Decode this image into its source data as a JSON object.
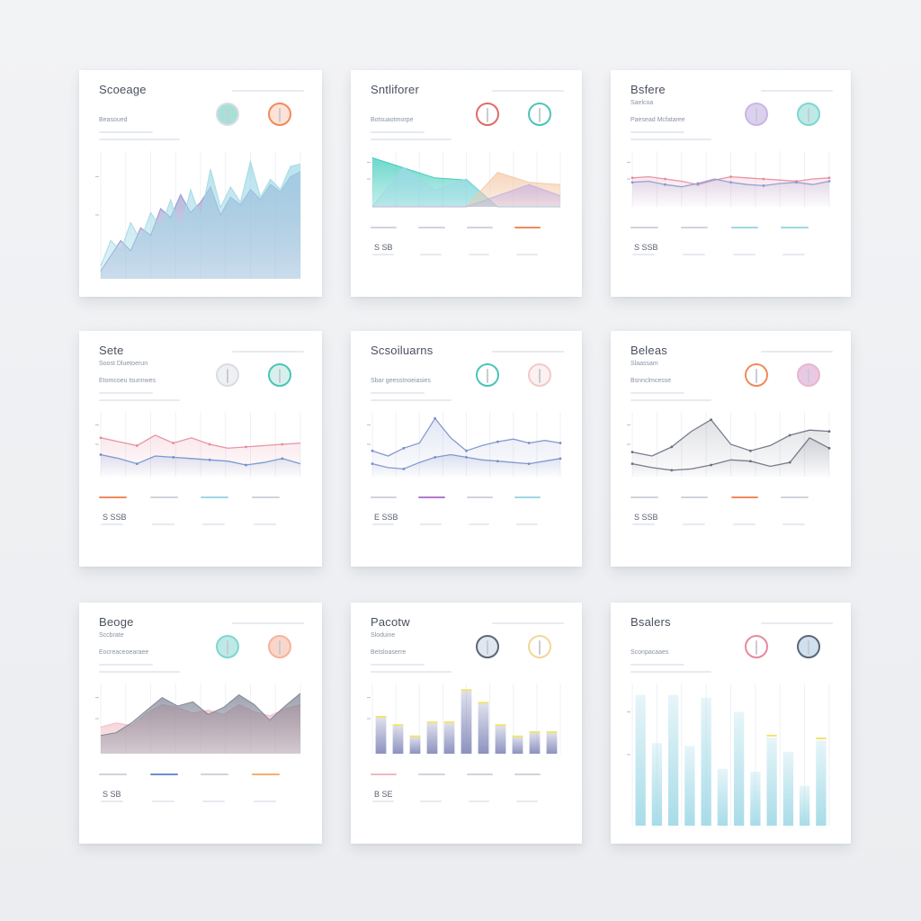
{
  "cards": [
    {
      "id": "card-1",
      "title": "Scoeage",
      "subtitle": "",
      "label": "Beasoued",
      "icons": [
        {
          "name": "gauge-icon",
          "ring": "#d9dde3",
          "fill": "#a8e0d8"
        },
        {
          "name": "gauge-icon",
          "ring": "#f08a5d",
          "fill": "#fde2d5"
        }
      ],
      "stats": [],
      "chart_data": {
        "type": "area",
        "x": [
          0,
          1,
          2,
          3,
          4,
          5,
          6,
          7,
          8,
          9,
          10,
          11,
          12,
          13,
          14,
          15,
          16,
          17,
          18,
          19,
          20
        ],
        "series": [
          {
            "name": "",
            "color": "#8f93c9",
            "values": [
              6,
              18,
              30,
              22,
              40,
              34,
              55,
              48,
              66,
              52,
              60,
              72,
              50,
              64,
              58,
              70,
              62,
              74,
              68,
              80,
              84
            ]
          },
          {
            "name": "",
            "color": "#9ed8e6",
            "values": [
              10,
              30,
              22,
              44,
              30,
              52,
              40,
              62,
              38,
              70,
              48,
              86,
              56,
              72,
              60,
              92,
              64,
              78,
              70,
              88,
              90
            ]
          }
        ],
        "ylim": [
          0,
          100
        ]
      }
    },
    {
      "id": "card-2",
      "title": "Sntliforer",
      "subtitle": "",
      "label": "Botsuaotmorpe",
      "icons": [
        {
          "name": "gauge-icon",
          "ring": "#e06a6a",
          "fill": "#ffffff"
        },
        {
          "name": "gauge-icon",
          "ring": "#4cc4b8",
          "fill": "#ffffff"
        }
      ],
      "stats": [
        {
          "value": "S SB",
          "caption": "",
          "dash": "#cfd4dc"
        },
        {
          "value": "",
          "caption": "",
          "dash": "#cfd4dc"
        },
        {
          "value": "",
          "caption": "",
          "dash": "#cfd4dc"
        },
        {
          "value": "",
          "caption": "",
          "dash": "#f08a5d"
        }
      ],
      "chart_data": {
        "type": "area",
        "categories": [
          "1",
          "2",
          "3",
          "4",
          "5",
          "6",
          "7"
        ],
        "series": [
          {
            "name": "",
            "color": "#36c9b9",
            "values": [
              88,
              70,
              52,
              48,
              0,
              0,
              0
            ]
          },
          {
            "name": "",
            "color": "#9ed8e6",
            "values": [
              0,
              70,
              30,
              50,
              0,
              0,
              0
            ]
          },
          {
            "name": "",
            "color": "#f4c7a4",
            "values": [
              0,
              0,
              0,
              0,
              62,
              44,
              40
            ]
          },
          {
            "name": "",
            "color": "#c7b0df",
            "values": [
              0,
              0,
              0,
              0,
              20,
              40,
              20
            ]
          }
        ],
        "ylim": [
          0,
          100
        ]
      }
    },
    {
      "id": "card-3",
      "title": "Bsfere",
      "subtitle": "Saelcoa",
      "label": "Paesead Mcfataree",
      "icons": [
        {
          "name": "gauge-icon",
          "ring": "#c9b6e4",
          "fill": "#dcd0ef"
        },
        {
          "name": "gauge-icon",
          "ring": "#7fd6d0",
          "fill": "#bde9e6"
        }
      ],
      "stats": [
        {
          "value": "S SSB",
          "caption": "",
          "dash": "#cfd4dc"
        },
        {
          "value": "",
          "caption": "",
          "dash": "#cfd4dc"
        },
        {
          "value": "",
          "caption": "",
          "dash": "#9ed8e6"
        },
        {
          "value": "",
          "caption": "",
          "dash": "#9ed8e6"
        }
      ],
      "chart_data": {
        "type": "line",
        "x": [
          0,
          1,
          2,
          3,
          4,
          5,
          6,
          7,
          8,
          9,
          10,
          11,
          12
        ],
        "series": [
          {
            "name": "",
            "color": "#e58a9d",
            "values": [
              52,
              54,
              50,
              46,
              40,
              48,
              54,
              52,
              50,
              48,
              46,
              50,
              52
            ]
          },
          {
            "name": "",
            "color": "#8a9ad6",
            "values": [
              44,
              46,
              40,
              36,
              42,
              50,
              44,
              40,
              38,
              42,
              44,
              40,
              46
            ]
          }
        ],
        "ylim": [
          0,
          100
        ]
      }
    },
    {
      "id": "card-4",
      "title": "Sete",
      "subtitle": "Soost Dluetoerun",
      "label": "Etomcoeu tsunnwes",
      "icons": [
        {
          "name": "gauge-icon",
          "ring": "#d9dde3",
          "fill": "#eef0f3"
        },
        {
          "name": "gauge-icon",
          "ring": "#4cc4b8",
          "fill": "#d7f0ee"
        }
      ],
      "stats": [
        {
          "value": "S SSB",
          "caption": "",
          "dash": "#f08a5d"
        },
        {
          "value": "",
          "caption": "",
          "dash": "#cfd4dc"
        },
        {
          "value": "",
          "caption": "",
          "dash": "#9ed8e6"
        },
        {
          "value": "",
          "caption": "",
          "dash": "#cfd4dc"
        }
      ],
      "chart_data": {
        "type": "line",
        "x": [
          0,
          1,
          2,
          3,
          4,
          5,
          6,
          7,
          8,
          9,
          10,
          11
        ],
        "series": [
          {
            "name": "",
            "color": "#e58a9d",
            "values": [
              60,
              54,
              48,
              64,
              52,
              60,
              50,
              44,
              46,
              48,
              50,
              52
            ]
          },
          {
            "name": "",
            "color": "#6f8fd0",
            "values": [
              34,
              28,
              20,
              32,
              30,
              28,
              26,
              24,
              18,
              22,
              28,
              20
            ]
          }
        ],
        "ylim": [
          0,
          100
        ]
      }
    },
    {
      "id": "card-5",
      "title": "Scsoiluarns",
      "subtitle": "",
      "label": "Sbar geesstnoeiasies",
      "icons": [
        {
          "name": "gauge-icon",
          "ring": "#4cc4b8",
          "fill": "#ffffff"
        },
        {
          "name": "gauge-icon",
          "ring": "#f1c9c9",
          "fill": "#fdf0f0"
        }
      ],
      "stats": [
        {
          "value": "E SSB",
          "caption": "",
          "dash": "#cfd4dc"
        },
        {
          "value": "",
          "caption": "",
          "dash": "#b07ad0"
        },
        {
          "value": "",
          "caption": "",
          "dash": "#cfd4dc"
        },
        {
          "value": "",
          "caption": "",
          "dash": "#9ed8e6"
        }
      ],
      "chart_data": {
        "type": "line",
        "x": [
          0,
          1,
          2,
          3,
          4,
          5,
          6,
          7,
          8,
          9,
          10,
          11,
          12
        ],
        "series": [
          {
            "name": "",
            "color": "#7a8fc9",
            "values": [
              40,
              32,
              44,
              52,
              90,
              60,
              40,
              48,
              54,
              58,
              52,
              56,
              52
            ]
          },
          {
            "name": "",
            "color": "#7a8fc9",
            "values": [
              20,
              14,
              12,
              22,
              30,
              34,
              30,
              26,
              24,
              22,
              20,
              24,
              28
            ]
          }
        ],
        "ylim": [
          0,
          100
        ]
      }
    },
    {
      "id": "card-6",
      "title": "Beleas",
      "subtitle": "Slaassam",
      "label": "Bsnnclmcesse",
      "icons": [
        {
          "name": "gauge-icon",
          "ring": "#f08a5d",
          "fill": "#ffffff"
        },
        {
          "name": "gauge-icon",
          "ring": "#e7b8ce",
          "fill": "#e9c8e4"
        }
      ],
      "stats": [
        {
          "value": "S SSB",
          "caption": "",
          "dash": "#cfd4dc"
        },
        {
          "value": "",
          "caption": "",
          "dash": "#cfd4dc"
        },
        {
          "value": "",
          "caption": "",
          "dash": "#f08a5d"
        },
        {
          "value": "",
          "caption": "",
          "dash": "#cfd4dc"
        }
      ],
      "chart_data": {
        "type": "line",
        "x": [
          0,
          1,
          2,
          3,
          4,
          5,
          6,
          7,
          8,
          9,
          10
        ],
        "series": [
          {
            "name": "",
            "color": "#6a6f80",
            "values": [
              38,
              32,
              46,
              70,
              88,
              50,
              40,
              48,
              64,
              72,
              70
            ]
          },
          {
            "name": "",
            "color": "#6a6f80",
            "values": [
              20,
              14,
              10,
              12,
              18,
              26,
              24,
              16,
              22,
              60,
              44
            ]
          }
        ],
        "ylim": [
          0,
          100
        ]
      }
    },
    {
      "id": "card-7",
      "title": "Beoge",
      "subtitle": "Sccbrate",
      "label": "Eocreaceoearaee",
      "icons": [
        {
          "name": "gauge-icon",
          "ring": "#7fd6d0",
          "fill": "#bde9e6"
        },
        {
          "name": "gauge-icon",
          "ring": "#f4b39e",
          "fill": "#fad6c8"
        }
      ],
      "stats": [
        {
          "value": "S SB",
          "caption": "",
          "dash": "#cfd4dc"
        },
        {
          "value": "",
          "caption": "",
          "dash": "#6f8fd0"
        },
        {
          "value": "",
          "caption": "",
          "dash": "#cfd4dc"
        },
        {
          "value": "",
          "caption": "",
          "dash": "#f4b06a"
        }
      ],
      "chart_data": {
        "type": "area",
        "x": [
          0,
          1,
          2,
          3,
          4,
          5,
          6,
          7,
          8,
          9,
          10,
          11,
          12,
          13
        ],
        "series": [
          {
            "name": "",
            "color": "#f0b7bf",
            "values": [
              38,
              44,
              40,
              58,
              70,
              66,
              58,
              62,
              56,
              70,
              60,
              54,
              64,
              70
            ]
          },
          {
            "name": "",
            "color": "#7a8090",
            "values": [
              26,
              30,
              44,
              62,
              80,
              68,
              74,
              56,
              66,
              84,
              70,
              48,
              68,
              86
            ]
          }
        ],
        "ylim": [
          0,
          100
        ]
      }
    },
    {
      "id": "card-8",
      "title": "Pacotw",
      "subtitle": "Sloduine",
      "label": "Betsloaserre",
      "icons": [
        {
          "name": "gauge-icon",
          "ring": "#5d6577",
          "fill": "#dfe7f0"
        },
        {
          "name": "gauge-icon",
          "ring": "#f2d69a",
          "fill": "#ffffff"
        }
      ],
      "stats": [
        {
          "value": "B SE",
          "caption": "",
          "dash": "#f0b7bf"
        },
        {
          "value": "",
          "caption": "",
          "dash": "#cfd4dc"
        },
        {
          "value": "",
          "caption": "",
          "dash": "#cfd4dc"
        },
        {
          "value": "",
          "caption": "",
          "dash": "#cfd4dc"
        }
      ],
      "chart_data": {
        "type": "bar",
        "categories": [
          "1",
          "2",
          "3",
          "4",
          "5",
          "6",
          "7",
          "8",
          "9",
          "10",
          "11"
        ],
        "series": [
          {
            "name": "",
            "color": "#7f86b8",
            "values": [
              52,
              40,
              24,
              44,
              44,
              90,
              72,
              40,
              24,
              30,
              30
            ]
          },
          {
            "name": "",
            "color": "#f2e46a",
            "values": [
              54,
              42,
              26,
              46,
              46,
              92,
              74,
              42,
              26,
              32,
              32
            ]
          }
        ],
        "ylim": [
          0,
          100
        ]
      }
    },
    {
      "id": "card-9",
      "title": "Bsalers",
      "subtitle": "",
      "label": "Sconpacaaes",
      "icons": [
        {
          "name": "gauge-icon",
          "ring": "#e58a9d",
          "fill": "#ffffff"
        },
        {
          "name": "gauge-icon",
          "ring": "#5d6577",
          "fill": "#cfe0ee"
        }
      ],
      "stats": [],
      "chart_data": {
        "type": "bar",
        "categories": [
          "1",
          "2",
          "3",
          "4",
          "5",
          "6",
          "7",
          "8",
          "9",
          "10",
          "11",
          "12"
        ],
        "series": [
          {
            "name": "",
            "color": "#9ed8e6",
            "values": [
              92,
              58,
              92,
              56,
              90,
              40,
              80,
              38,
              62,
              52,
              28,
              60
            ]
          },
          {
            "name": "",
            "color": "#f2e46a",
            "values": [
              0,
              0,
              0,
              0,
              0,
              0,
              0,
              0,
              64,
              0,
              0,
              62
            ]
          }
        ],
        "ylim": [
          0,
          100
        ]
      }
    }
  ]
}
